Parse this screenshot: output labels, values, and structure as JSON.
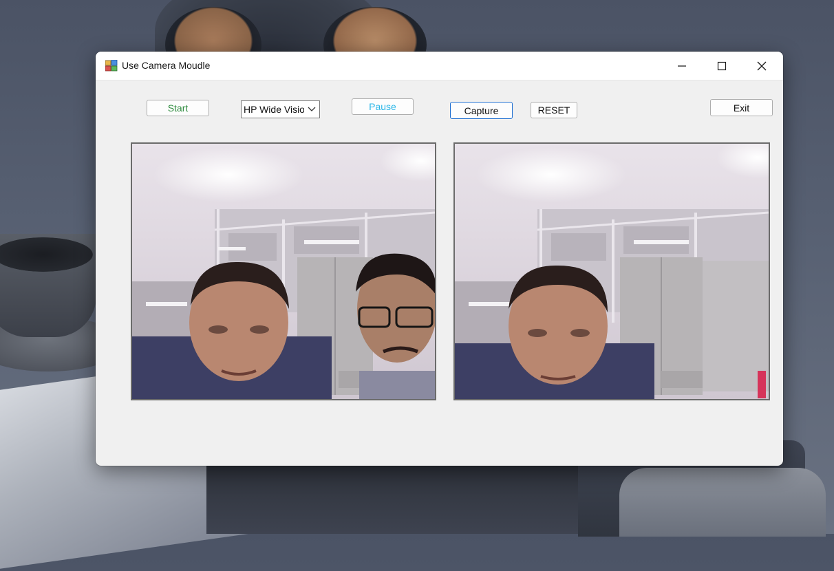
{
  "window": {
    "title": "Use Camera Moudle"
  },
  "titlebar": {
    "minimize_icon": "minimize-icon",
    "maximize_icon": "maximize-icon",
    "close_icon": "close-icon"
  },
  "toolbar": {
    "start_label": "Start",
    "camera_select_value": "HP Wide Vision",
    "pause_label": "Pause",
    "capture_label": "Capture",
    "reset_label": "RESET",
    "exit_label": "Exit"
  },
  "colors": {
    "start_text": "#2e8b3e",
    "pause_text": "#29b6e8",
    "capture_focus_border": "#1f6fd1"
  },
  "panels": {
    "live_feed": "camera-live-feed",
    "captured_image": "captured-image"
  }
}
